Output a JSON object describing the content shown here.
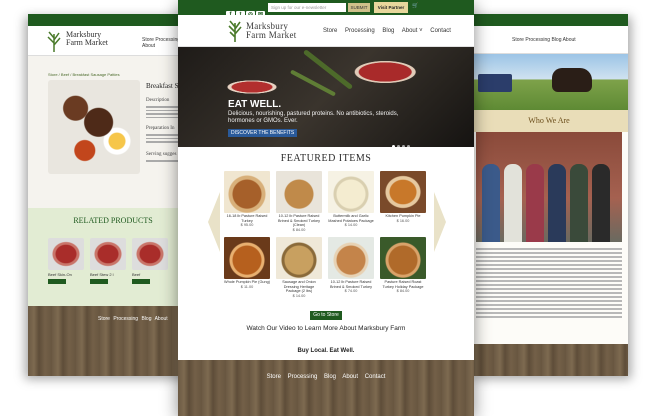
{
  "center": {
    "signup_placeholder": "Sign up for our e-newsletter",
    "submit_label": "SUBMIT",
    "visit_label": "Visit Partner Site",
    "brand_line1": "Marksbury",
    "brand_line2": "Farm Market",
    "nav": [
      "Store",
      "Processing",
      "Blog",
      "About ˅",
      "Contact"
    ],
    "hero": {
      "title": "EAT WELL.",
      "text": "Delicious, nourishing, pastured proteins. No antibiotics, steroids, hormones or GMOs. Ever.",
      "button": "DISCOVER THE BENEFITS"
    },
    "featured_title": "FEATURED ITEMS",
    "products": [
      {
        "name": "16-18 lb Pasture Raised Turkey",
        "price": "$ 95.00"
      },
      {
        "name": "10-12 lb Pasture Raised Brined & Smoked Turkey (Clean)",
        "price": "$ 84.00"
      },
      {
        "name": "Buttermilk and Garlic Mashed Potatoes Package",
        "price": "$ 14.00"
      },
      {
        "name": "Kitchen Pumpkin Pie",
        "price": "$ 16.00"
      },
      {
        "name": "Whole Pumpkin Pie (Gung)",
        "price": "$ 11.00"
      },
      {
        "name": "Sausage and Onion Dressing Heritage Package (2 lbs)",
        "price": "$ 14.00"
      },
      {
        "name": "10-12 lb Pasture Raised Brined & Smoked Turkey",
        "price": "$ 74.00"
      },
      {
        "name": "Pasture Raised Roast Turkey Holiday Package",
        "price": "$ 84.00"
      }
    ],
    "go_button": "Go to Store",
    "video_text": "Watch Our Video to Learn More About Marksbury Farm",
    "tagline": "Buy Local. Eat Well.",
    "footer_nav": [
      "Store",
      "Processing",
      "Blog",
      "About",
      "Contact"
    ]
  },
  "left": {
    "brand_line1": "Marksbury",
    "brand_line2": "Farm Market",
    "nav": "Store  Processing  Blog  About",
    "crumb": "Store / Beef / Breakfast Sausage Patties",
    "title": "Breakfast S",
    "description": "Description",
    "preparation": "Preparation In",
    "serving": "Serving sugges",
    "related_title": "RELATED PRODUCTS",
    "related": [
      "Beef Skin-On",
      "Beef Stew 2 l",
      "Beef"
    ],
    "footer_nav": "Store  Processing  Blog  About"
  },
  "right": {
    "nav": "Store  Processing  Blog  About",
    "who_title": "Who We Are"
  },
  "colors": {
    "brand_green": "#1f5a1f",
    "gold": "#e8d79c",
    "hero_button": "#2a5a9a"
  }
}
